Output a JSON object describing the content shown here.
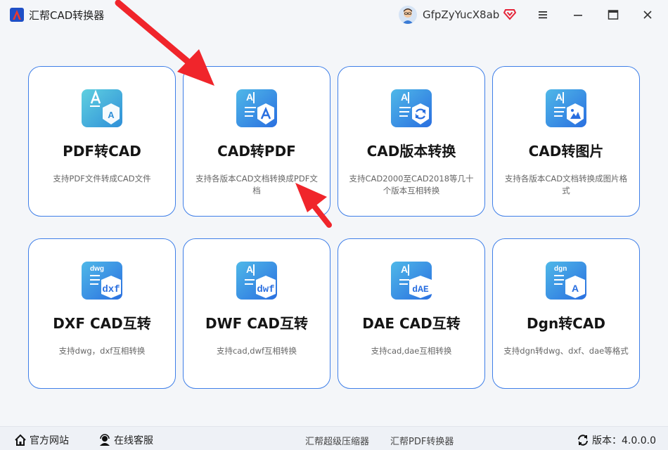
{
  "app": {
    "title": "汇帮CAD转换器"
  },
  "user": {
    "name": "GfpZyYucX8ab"
  },
  "cards": [
    {
      "title": "PDF转CAD",
      "desc": "支持PDF文件转成CAD文件"
    },
    {
      "title": "CAD转PDF",
      "desc": "支持各版本CAD文档转换成PDF文档"
    },
    {
      "title": "CAD版本转换",
      "desc": "支持CAD2000至CAD2018等几十个版本互相转换"
    },
    {
      "title": "CAD转图片",
      "desc": "支持各版本CAD文档转换成图片格式"
    },
    {
      "title": "DXF CAD互转",
      "desc": "支持dwg，dxf互相转换",
      "badge": "dxf",
      "tag": "dwg"
    },
    {
      "title": "DWF CAD互转",
      "desc": "支持cad,dwf互相转换",
      "badge": "dwf"
    },
    {
      "title": "DAE CAD互转",
      "desc": "支持cad,dae互相转换",
      "badge": "dAE"
    },
    {
      "title": "Dgn转CAD",
      "desc": "支持dgn转dwg、dxf、dae等格式",
      "badge": "A",
      "tag": "dgn"
    }
  ],
  "footer": {
    "website": "官方网站",
    "support": "在线客服",
    "link1": "汇帮超级压缩器",
    "link2": "汇帮PDF转换器",
    "version_label": "版本：4.0.0.0"
  },
  "colors": {
    "accent": "#3f7fe8",
    "arrow": "#f0252b",
    "icon_teal": "#3ab3d4",
    "icon_blue": "#2f6fe0"
  }
}
